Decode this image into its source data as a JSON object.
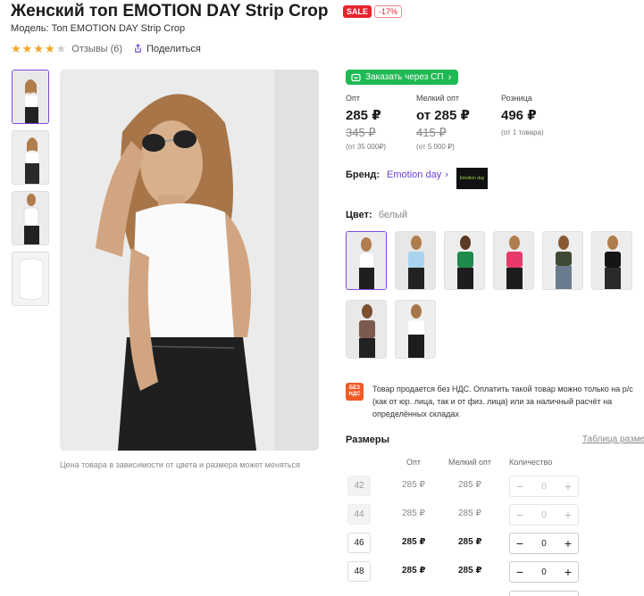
{
  "product": {
    "title": "Женский топ EMOTION DAY Strip Crop",
    "sale_badge": "SALE",
    "discount_badge": "-17%",
    "model": "Модель: Топ EMOTION DAY Strip Crop",
    "rating": 4,
    "reviews": "Отзывы (6)",
    "share": "Поделиться"
  },
  "gallery": {
    "caption": "Цена товара в зависимости от цвета и размера может меняться"
  },
  "order_button": "Заказать через СП",
  "prices": [
    {
      "label": "Опт",
      "now": "285 ₽",
      "old": "345 ₽",
      "note": "(от 35 000₽)"
    },
    {
      "label": "Мелкий опт",
      "now": "от 285 ₽",
      "old": "415 ₽",
      "note": "(от 5 000 ₽)"
    },
    {
      "label": "Розница",
      "now": "496 ₽",
      "old": "",
      "note": "(от 1 товара)"
    }
  ],
  "brand": {
    "label": "Бренд:",
    "value": "Emotion day",
    "logo_text": "Emotion day"
  },
  "color": {
    "label": "Цвет:",
    "value": "белый"
  },
  "swatches": [
    "white",
    "light-blue",
    "green",
    "pink",
    "olive",
    "black",
    "brown",
    "white-2"
  ],
  "vat": {
    "icon": "БЕЗ НДС",
    "text": "Товар продается без НДС. Оплатить такой товар можно только на р/с (как от юр. лица, так и от физ. лица) или за наличный расчёт на определённых складах"
  },
  "sizes": {
    "title": "Размеры",
    "table_link": "Таблица размеров",
    "headers": {
      "opt": "Опт",
      "small_opt": "Мелкий опт",
      "qty": "Количество"
    },
    "rows": [
      {
        "size": "42",
        "opt": "285 ₽",
        "small": "285 ₽",
        "qty": "0",
        "enabled": false
      },
      {
        "size": "44",
        "opt": "285 ₽",
        "small": "285 ₽",
        "qty": "0",
        "enabled": false
      },
      {
        "size": "46",
        "opt": "285 ₽",
        "small": "285 ₽",
        "qty": "0",
        "enabled": true
      },
      {
        "size": "48",
        "opt": "285 ₽",
        "small": "285 ₽",
        "qty": "0",
        "enabled": true
      }
    ]
  }
}
